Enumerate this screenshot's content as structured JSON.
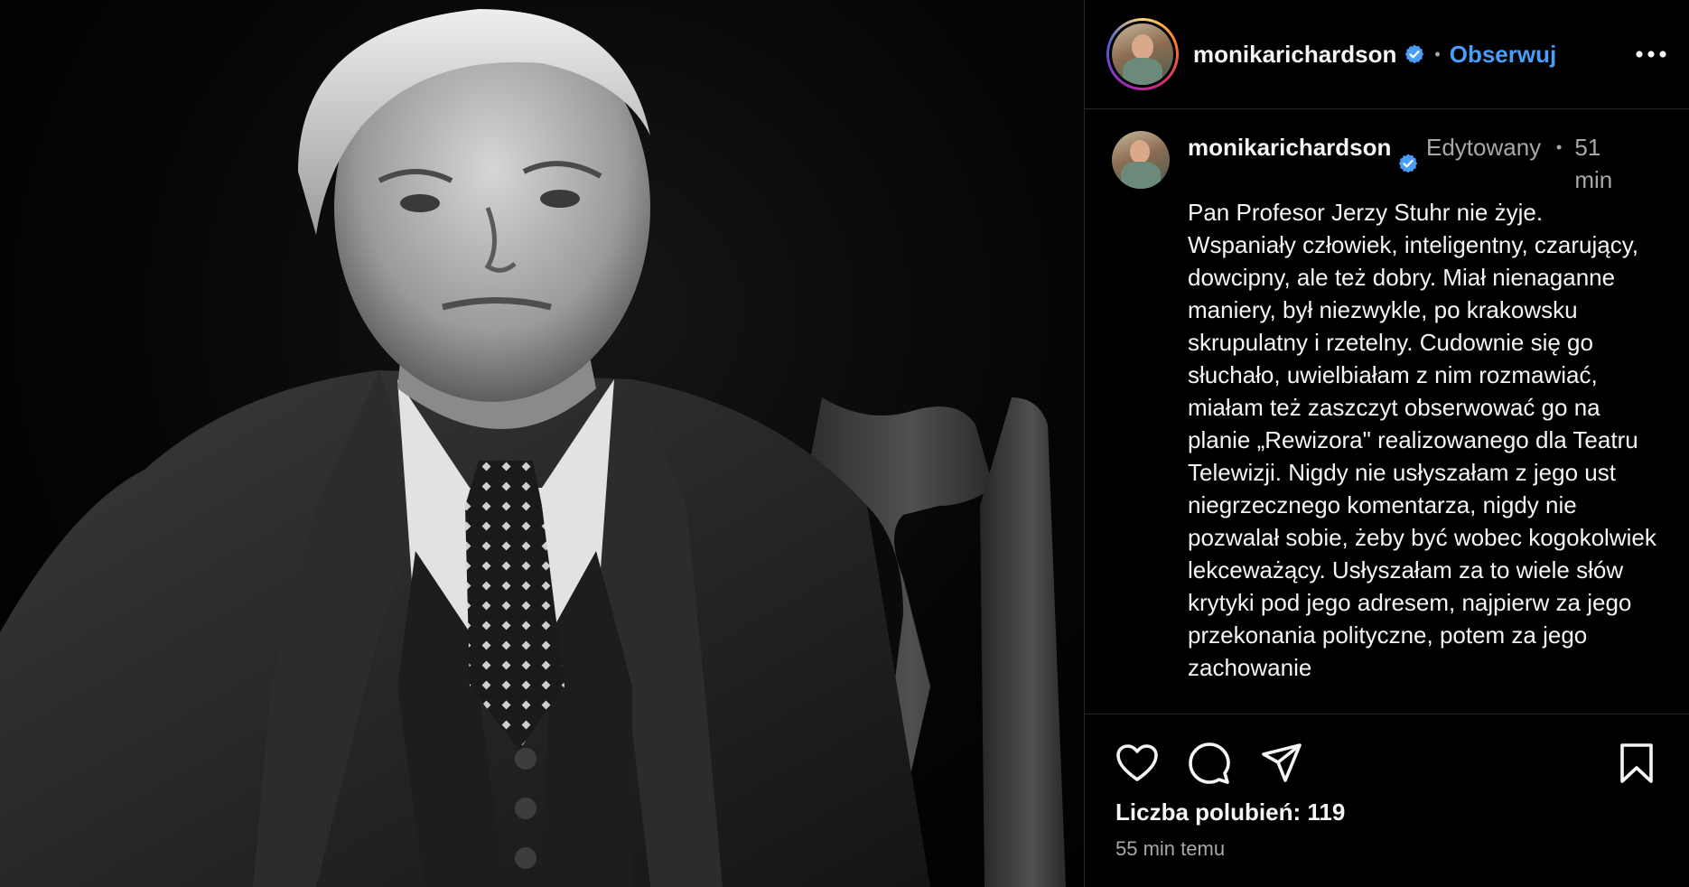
{
  "post": {
    "username": "monikarichardson",
    "follow_label": "Obserwuj",
    "dot": "•"
  },
  "caption": {
    "username": "monikarichardson",
    "edited_label": "Edytowany",
    "time": "51 min",
    "text": "Pan Profesor Jerzy Stuhr nie żyje. Wspaniały człowiek, inteligentny, czarujący, dowcipny, ale też dobry. Miał nienaganne maniery, był niezwykle, po krakowsku skrupulatny i rzetelny. Cudownie się go słuchało, uwielbiałam z nim rozmawiać, miałam też zaszczyt obserwować go na planie „Rewizora\" realizowanego dla Teatru Telewizji. Nigdy nie usłyszałam z jego ust niegrzecznego komentarza, nigdy nie pozwalał sobie, żeby być wobec kogokolwiek lekceważący. Usłyszałam za to wiele słów krytyki pod jego adresem, najpierw za jego przekonania polityczne, potem za jego zachowanie"
  },
  "stats": {
    "likes": "Liczba polubień: 119",
    "posted_ago": "55 min temu"
  },
  "icons": {
    "more": "more-options-icon",
    "like": "heart-icon",
    "comment": "comment-icon",
    "share": "share-icon",
    "save": "bookmark-icon",
    "verified": "verified-badge-icon"
  },
  "colors": {
    "link": "#4a9df8",
    "verified": "#4a9df8",
    "muted": "#a8a8a8"
  }
}
